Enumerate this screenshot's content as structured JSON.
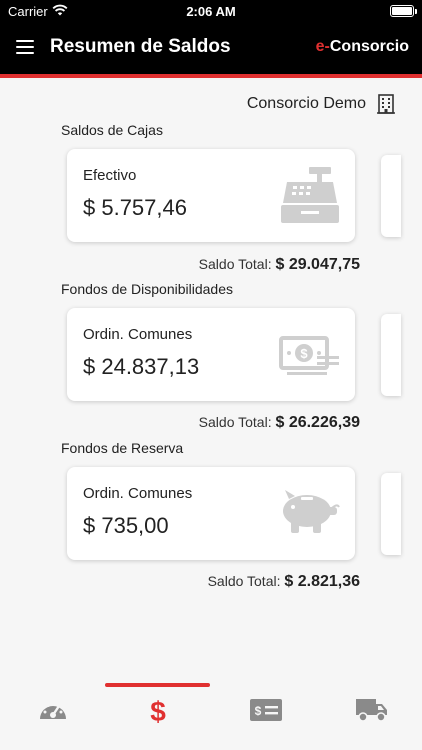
{
  "status_bar": {
    "carrier": "Carrier",
    "time": "2:06 AM"
  },
  "header": {
    "title": "Resumen de Saldos",
    "logo_prefix": "e-",
    "logo_name": "Consorcio"
  },
  "consorcio": {
    "name": "Consorcio Demo"
  },
  "sections": {
    "cajas": {
      "title": "Saldos de Cajas",
      "card": {
        "label": "Efectivo",
        "value": "$ 5.757,46",
        "icon": "cash-register-icon"
      },
      "total_label": "Saldo Total:",
      "total_value": "$ 29.047,75"
    },
    "disponibilidades": {
      "title": "Fondos de Disponibilidades",
      "card": {
        "label": "Ordin. Comunes",
        "value": "$ 24.837,13",
        "icon": "money-bill-icon"
      },
      "total_label": "Saldo Total:",
      "total_value": "$ 26.226,39"
    },
    "reserva": {
      "title": "Fondos de Reserva",
      "card": {
        "label": "Ordin. Comunes",
        "value": "$ 735,00",
        "icon": "piggy-bank-icon"
      },
      "total_label": "Saldo Total:",
      "total_value": "$ 2.821,36"
    }
  },
  "tabs": [
    {
      "icon": "dashboard-icon",
      "active": false
    },
    {
      "icon": "dollar-icon",
      "active": true
    },
    {
      "icon": "check-icon",
      "active": false
    },
    {
      "icon": "truck-icon",
      "active": false
    }
  ],
  "colors": {
    "accent": "#e03030",
    "header_bg": "#000000",
    "icon_gray": "#c8c8c8",
    "tab_gray": "#8a8a8a"
  }
}
